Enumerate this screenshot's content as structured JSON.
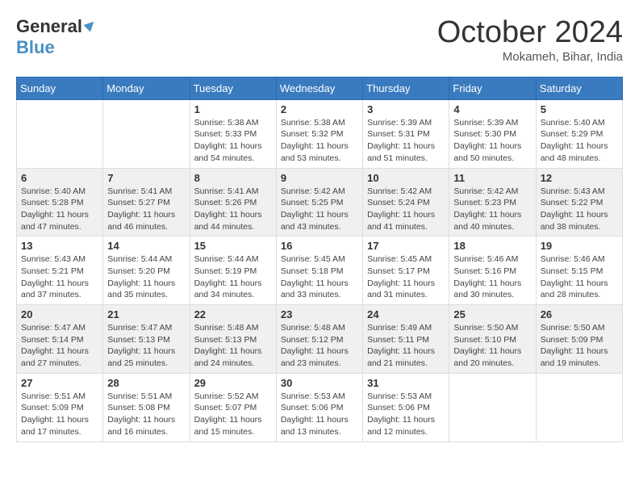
{
  "header": {
    "logo_general": "General",
    "logo_blue": "Blue",
    "month_title": "October 2024",
    "location": "Mokameh, Bihar, India"
  },
  "calendar": {
    "days_of_week": [
      "Sunday",
      "Monday",
      "Tuesday",
      "Wednesday",
      "Thursday",
      "Friday",
      "Saturday"
    ],
    "weeks": [
      [
        {
          "day": "",
          "sunrise": "",
          "sunset": "",
          "daylight": ""
        },
        {
          "day": "",
          "sunrise": "",
          "sunset": "",
          "daylight": ""
        },
        {
          "day": "1",
          "sunrise": "Sunrise: 5:38 AM",
          "sunset": "Sunset: 5:33 PM",
          "daylight": "Daylight: 11 hours and 54 minutes."
        },
        {
          "day": "2",
          "sunrise": "Sunrise: 5:38 AM",
          "sunset": "Sunset: 5:32 PM",
          "daylight": "Daylight: 11 hours and 53 minutes."
        },
        {
          "day": "3",
          "sunrise": "Sunrise: 5:39 AM",
          "sunset": "Sunset: 5:31 PM",
          "daylight": "Daylight: 11 hours and 51 minutes."
        },
        {
          "day": "4",
          "sunrise": "Sunrise: 5:39 AM",
          "sunset": "Sunset: 5:30 PM",
          "daylight": "Daylight: 11 hours and 50 minutes."
        },
        {
          "day": "5",
          "sunrise": "Sunrise: 5:40 AM",
          "sunset": "Sunset: 5:29 PM",
          "daylight": "Daylight: 11 hours and 48 minutes."
        }
      ],
      [
        {
          "day": "6",
          "sunrise": "Sunrise: 5:40 AM",
          "sunset": "Sunset: 5:28 PM",
          "daylight": "Daylight: 11 hours and 47 minutes."
        },
        {
          "day": "7",
          "sunrise": "Sunrise: 5:41 AM",
          "sunset": "Sunset: 5:27 PM",
          "daylight": "Daylight: 11 hours and 46 minutes."
        },
        {
          "day": "8",
          "sunrise": "Sunrise: 5:41 AM",
          "sunset": "Sunset: 5:26 PM",
          "daylight": "Daylight: 11 hours and 44 minutes."
        },
        {
          "day": "9",
          "sunrise": "Sunrise: 5:42 AM",
          "sunset": "Sunset: 5:25 PM",
          "daylight": "Daylight: 11 hours and 43 minutes."
        },
        {
          "day": "10",
          "sunrise": "Sunrise: 5:42 AM",
          "sunset": "Sunset: 5:24 PM",
          "daylight": "Daylight: 11 hours and 41 minutes."
        },
        {
          "day": "11",
          "sunrise": "Sunrise: 5:42 AM",
          "sunset": "Sunset: 5:23 PM",
          "daylight": "Daylight: 11 hours and 40 minutes."
        },
        {
          "day": "12",
          "sunrise": "Sunrise: 5:43 AM",
          "sunset": "Sunset: 5:22 PM",
          "daylight": "Daylight: 11 hours and 38 minutes."
        }
      ],
      [
        {
          "day": "13",
          "sunrise": "Sunrise: 5:43 AM",
          "sunset": "Sunset: 5:21 PM",
          "daylight": "Daylight: 11 hours and 37 minutes."
        },
        {
          "day": "14",
          "sunrise": "Sunrise: 5:44 AM",
          "sunset": "Sunset: 5:20 PM",
          "daylight": "Daylight: 11 hours and 35 minutes."
        },
        {
          "day": "15",
          "sunrise": "Sunrise: 5:44 AM",
          "sunset": "Sunset: 5:19 PM",
          "daylight": "Daylight: 11 hours and 34 minutes."
        },
        {
          "day": "16",
          "sunrise": "Sunrise: 5:45 AM",
          "sunset": "Sunset: 5:18 PM",
          "daylight": "Daylight: 11 hours and 33 minutes."
        },
        {
          "day": "17",
          "sunrise": "Sunrise: 5:45 AM",
          "sunset": "Sunset: 5:17 PM",
          "daylight": "Daylight: 11 hours and 31 minutes."
        },
        {
          "day": "18",
          "sunrise": "Sunrise: 5:46 AM",
          "sunset": "Sunset: 5:16 PM",
          "daylight": "Daylight: 11 hours and 30 minutes."
        },
        {
          "day": "19",
          "sunrise": "Sunrise: 5:46 AM",
          "sunset": "Sunset: 5:15 PM",
          "daylight": "Daylight: 11 hours and 28 minutes."
        }
      ],
      [
        {
          "day": "20",
          "sunrise": "Sunrise: 5:47 AM",
          "sunset": "Sunset: 5:14 PM",
          "daylight": "Daylight: 11 hours and 27 minutes."
        },
        {
          "day": "21",
          "sunrise": "Sunrise: 5:47 AM",
          "sunset": "Sunset: 5:13 PM",
          "daylight": "Daylight: 11 hours and 25 minutes."
        },
        {
          "day": "22",
          "sunrise": "Sunrise: 5:48 AM",
          "sunset": "Sunset: 5:13 PM",
          "daylight": "Daylight: 11 hours and 24 minutes."
        },
        {
          "day": "23",
          "sunrise": "Sunrise: 5:48 AM",
          "sunset": "Sunset: 5:12 PM",
          "daylight": "Daylight: 11 hours and 23 minutes."
        },
        {
          "day": "24",
          "sunrise": "Sunrise: 5:49 AM",
          "sunset": "Sunset: 5:11 PM",
          "daylight": "Daylight: 11 hours and 21 minutes."
        },
        {
          "day": "25",
          "sunrise": "Sunrise: 5:50 AM",
          "sunset": "Sunset: 5:10 PM",
          "daylight": "Daylight: 11 hours and 20 minutes."
        },
        {
          "day": "26",
          "sunrise": "Sunrise: 5:50 AM",
          "sunset": "Sunset: 5:09 PM",
          "daylight": "Daylight: 11 hours and 19 minutes."
        }
      ],
      [
        {
          "day": "27",
          "sunrise": "Sunrise: 5:51 AM",
          "sunset": "Sunset: 5:09 PM",
          "daylight": "Daylight: 11 hours and 17 minutes."
        },
        {
          "day": "28",
          "sunrise": "Sunrise: 5:51 AM",
          "sunset": "Sunset: 5:08 PM",
          "daylight": "Daylight: 11 hours and 16 minutes."
        },
        {
          "day": "29",
          "sunrise": "Sunrise: 5:52 AM",
          "sunset": "Sunset: 5:07 PM",
          "daylight": "Daylight: 11 hours and 15 minutes."
        },
        {
          "day": "30",
          "sunrise": "Sunrise: 5:53 AM",
          "sunset": "Sunset: 5:06 PM",
          "daylight": "Daylight: 11 hours and 13 minutes."
        },
        {
          "day": "31",
          "sunrise": "Sunrise: 5:53 AM",
          "sunset": "Sunset: 5:06 PM",
          "daylight": "Daylight: 11 hours and 12 minutes."
        },
        {
          "day": "",
          "sunrise": "",
          "sunset": "",
          "daylight": ""
        },
        {
          "day": "",
          "sunrise": "",
          "sunset": "",
          "daylight": ""
        }
      ]
    ]
  }
}
